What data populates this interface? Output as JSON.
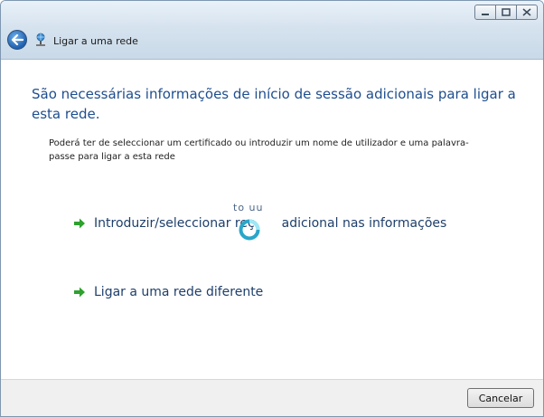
{
  "window": {
    "title": "Ligar a uma rede",
    "controls": [
      "minimize-icon",
      "maximize-icon",
      "close-icon"
    ]
  },
  "main": {
    "heading": "São necessárias informações de início de sessão adicionais para ligar a esta rede.",
    "description": "Poderá ter de seleccionar um certificado ou introduzir um nome de utilizador e uma palavra-passe para ligar a esta rede",
    "commands": [
      {
        "label": "Introduzir/seleccionar reç",
        "label_tail": "adicional nas informações",
        "overlay": "to uu",
        "icon": "green-arrow-icon"
      },
      {
        "label": "Ligar a uma rede diferente",
        "icon": "green-arrow-icon"
      }
    ]
  },
  "footer": {
    "cancel_label": "Cancelar"
  },
  "colors": {
    "heading": "#1e4e8f",
    "link": "#1e3f6b",
    "arrow": "#2ea12e",
    "footer_bg": "#f0f0f0"
  }
}
